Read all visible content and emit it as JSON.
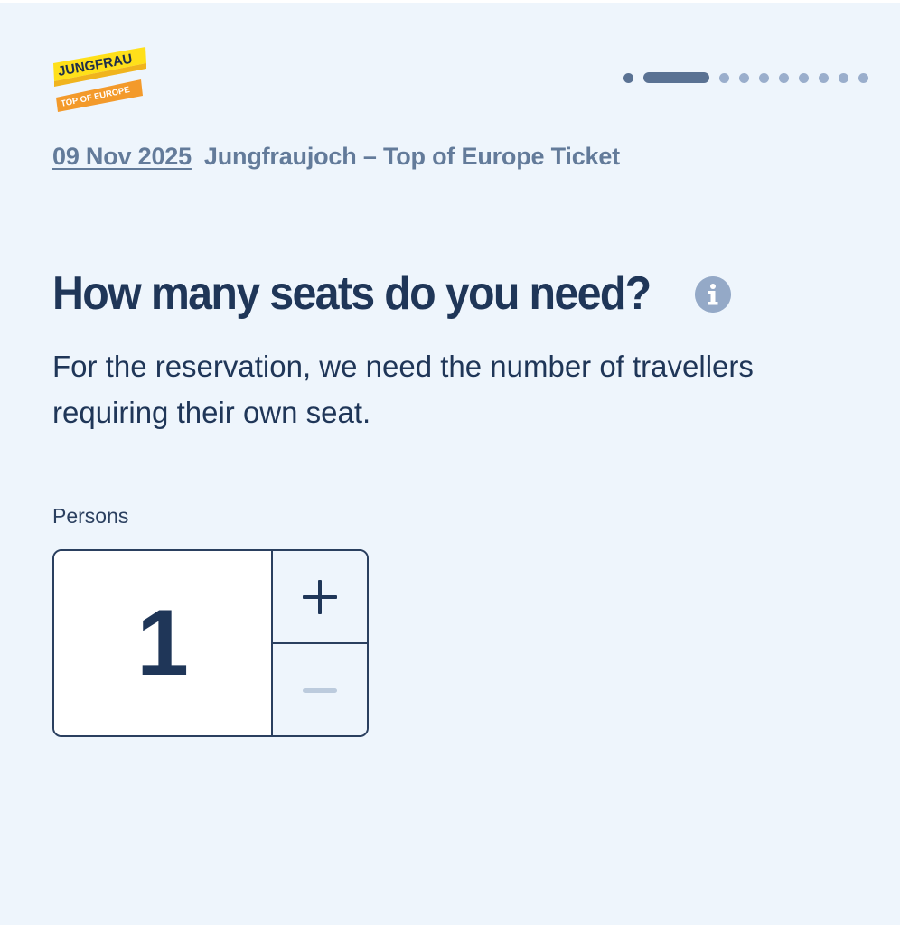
{
  "logo": {
    "line1": "JUNGFRAU",
    "line2": "TOP OF EUROPE"
  },
  "progress": {
    "total_steps": 10,
    "current_step": 2
  },
  "breadcrumb": {
    "date": "09 Nov 2025",
    "product": "Jungfraujoch – Top of Europe Ticket"
  },
  "question": {
    "title": "How many seats do you need?",
    "info_icon": "info-icon",
    "description": "For the reservation, we need the number of travellers requiring their own seat."
  },
  "persons": {
    "label": "Persons",
    "value": "1",
    "increment_icon": "plus-icon",
    "decrement_icon": "minus-icon",
    "decrement_disabled": true
  },
  "colors": {
    "background": "#eef5fc",
    "primary_text": "#1f3658",
    "muted_text": "#637b9a",
    "dot_active": "#5a7293",
    "dot_inactive": "#9aaecc",
    "logo_yellow": "#ffe01a",
    "logo_orange": "#f39a2b"
  }
}
